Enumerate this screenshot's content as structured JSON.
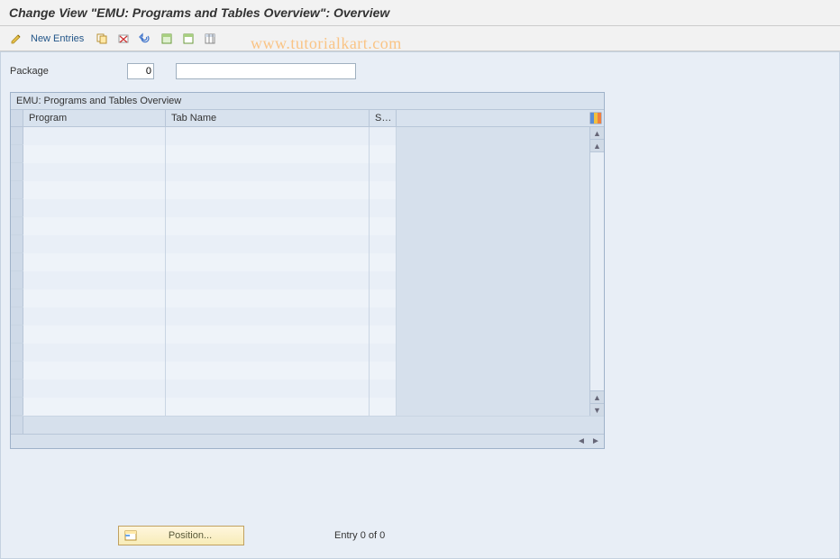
{
  "header": {
    "title": "Change View \"EMU: Programs and Tables Overview\": Overview"
  },
  "toolbar": {
    "new_entries_label": "New Entries",
    "icons": {
      "edit": "edit-icon",
      "copy": "copy-icon",
      "delete": "delete-icon",
      "undo": "undo-icon",
      "select_all": "select-all-icon",
      "deselect": "deselect-icon",
      "config": "table-settings-icon"
    }
  },
  "watermark": "www.tutorialkart.com",
  "package": {
    "label": "Package",
    "value": "0",
    "desc": ""
  },
  "table": {
    "title": "EMU: Programs and Tables Overview",
    "columns": [
      "Program",
      "Tab Name",
      "Su..."
    ],
    "row_count": 16
  },
  "footer": {
    "position_label": "Position...",
    "entry_text": "Entry 0 of 0"
  }
}
